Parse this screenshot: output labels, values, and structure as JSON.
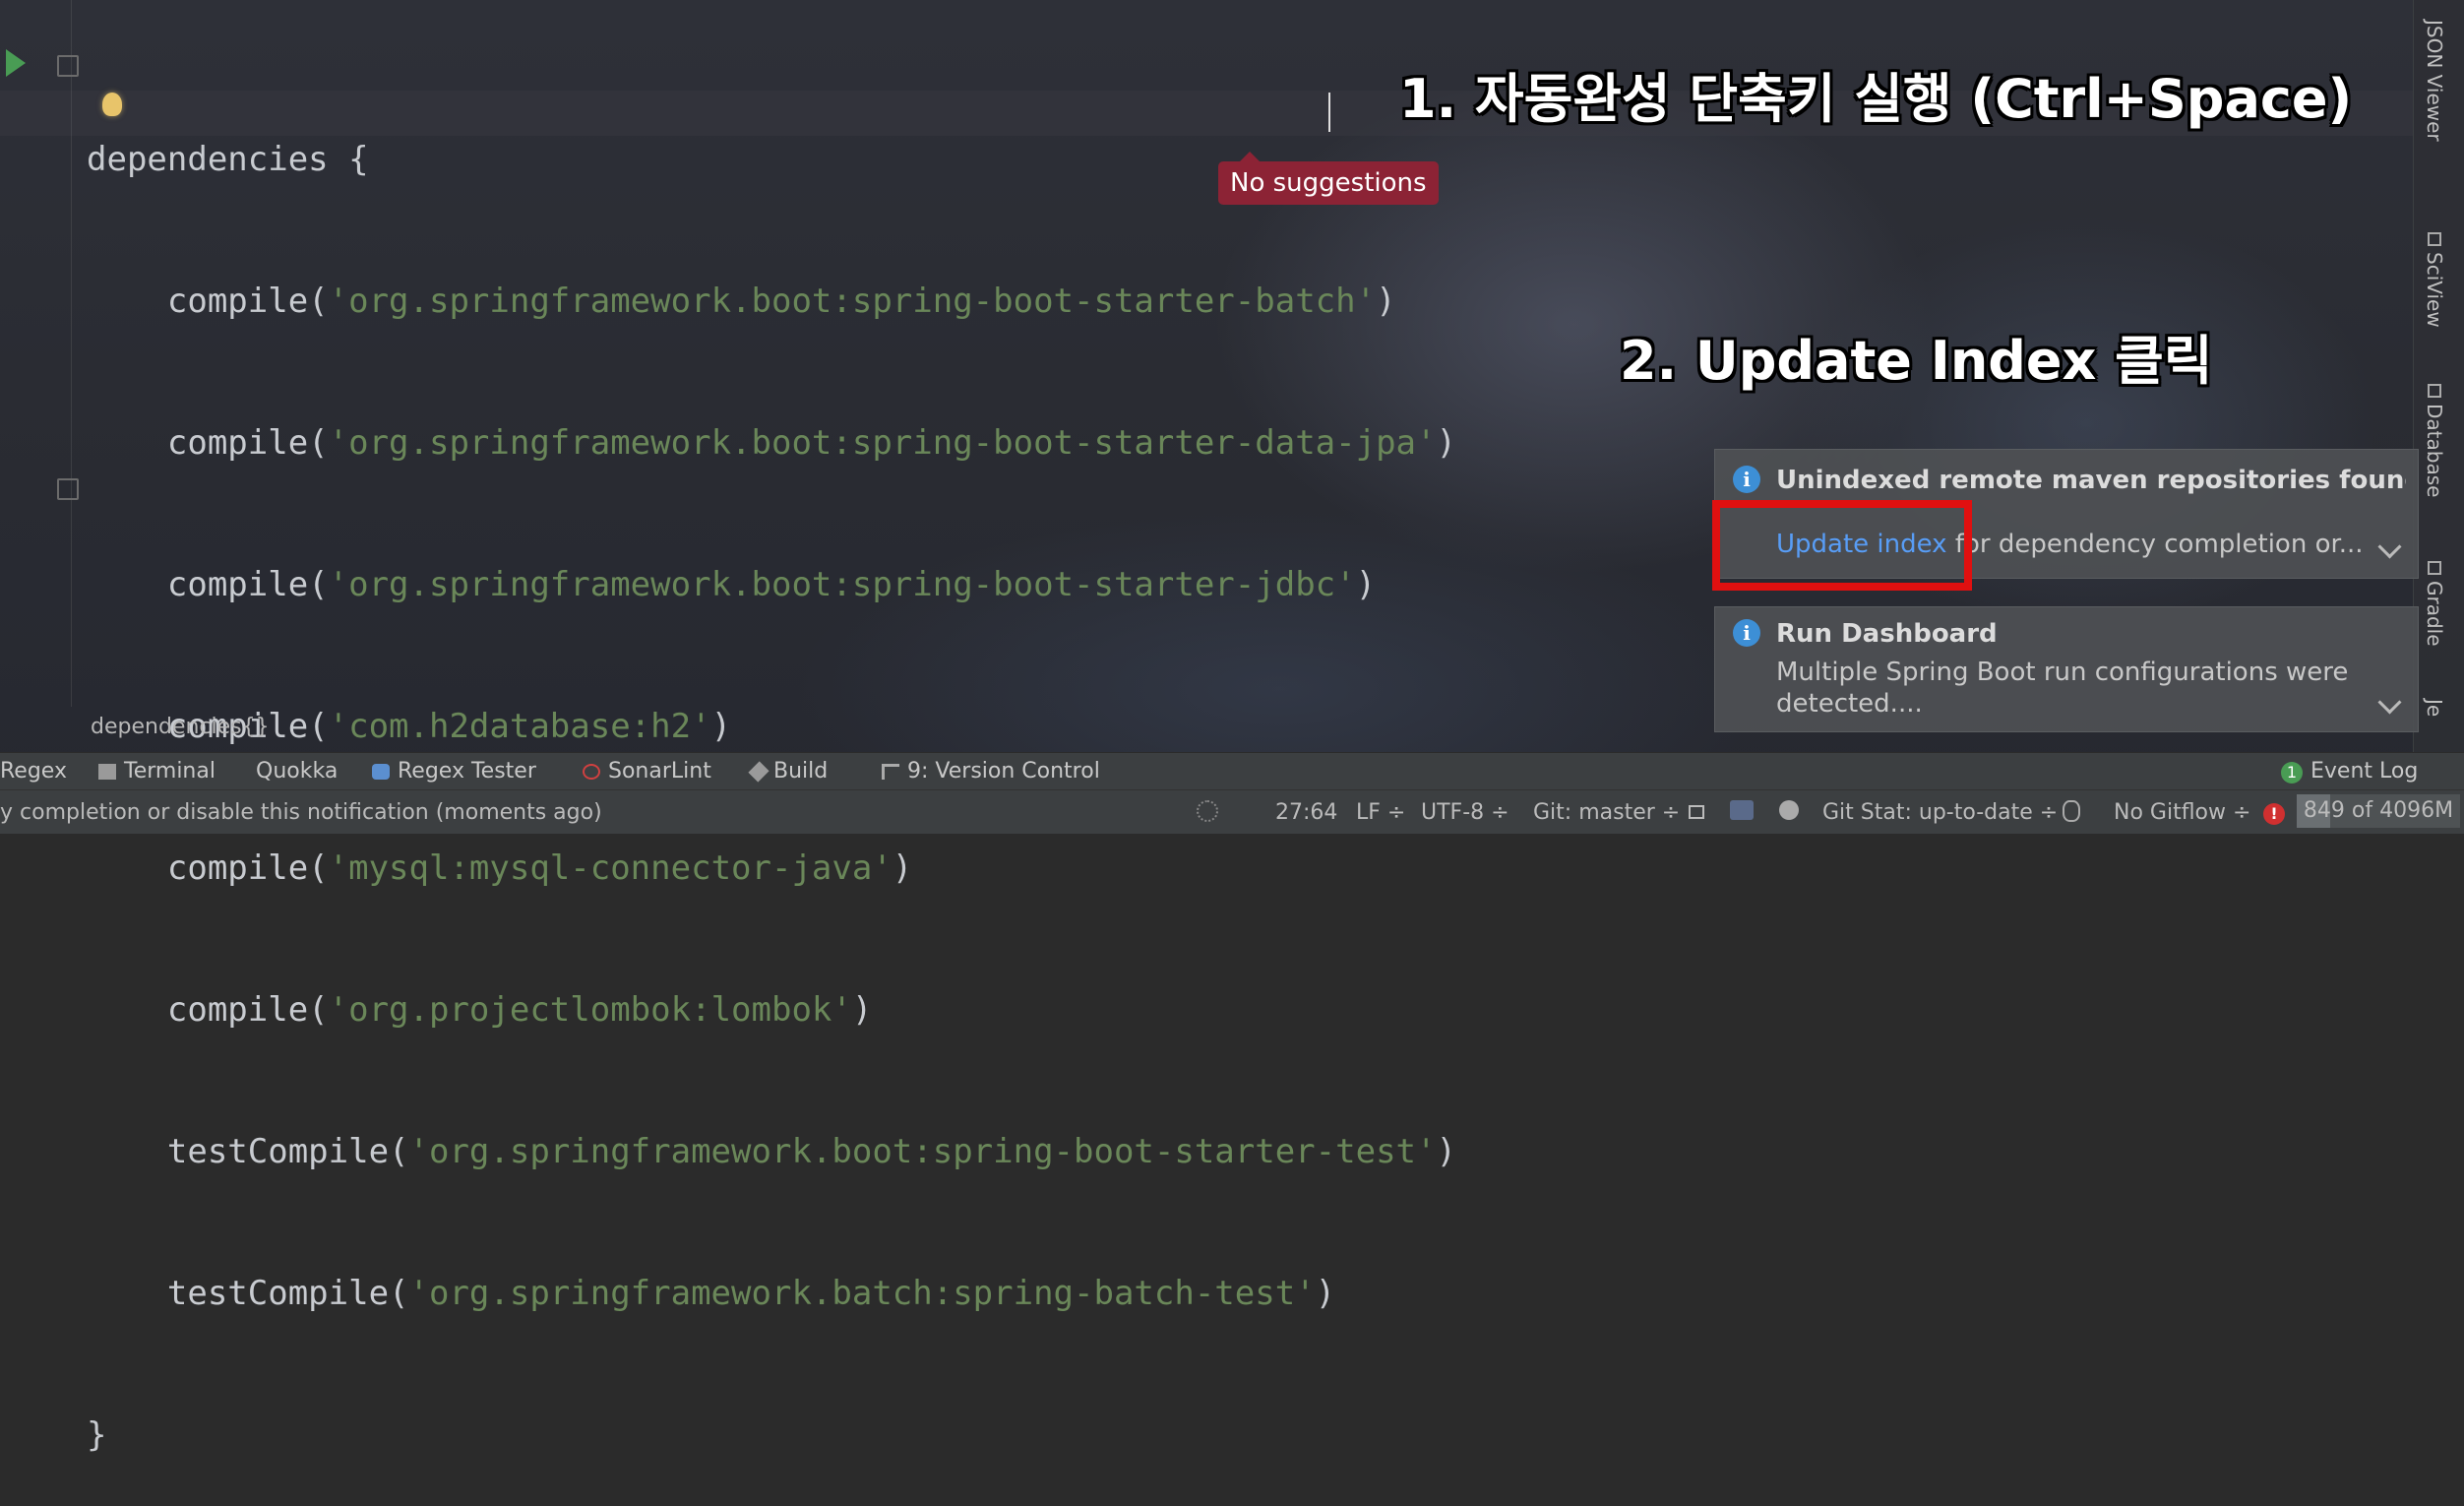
{
  "editor": {
    "lines": [
      {
        "pre": "dependencies {",
        "str": "",
        "post": ""
      },
      {
        "pre": "    compile(",
        "str": "'org.springframework.boot:spring-boot-starter-batch'",
        "post": ")"
      },
      {
        "pre": "    compile(",
        "str": "'org.springframework.boot:spring-boot-starter-data-jpa'",
        "post": ")"
      },
      {
        "pre": "    compile(",
        "str": "'org.springframework.boot:spring-boot-starter-jdbc'",
        "post": ")"
      },
      {
        "pre": "    compile(",
        "str": "'com.h2database:h2'",
        "post": ")"
      },
      {
        "pre": "    compile(",
        "str": "'mysql:mysql-connector-java'",
        "post": ")"
      },
      {
        "pre": "    compile(",
        "str": "'org.projectlombok:lombok'",
        "post": ")"
      },
      {
        "pre": "    testCompile(",
        "str": "'org.springframework.boot:spring-boot-starter-test'",
        "post": ")"
      },
      {
        "pre": "    testCompile(",
        "str": "'org.springframework.batch:spring-batch-test'",
        "post": ")"
      },
      {
        "pre": "}",
        "str": "",
        "post": ""
      }
    ],
    "tooltip": "No suggestions",
    "breadcrumb": "dependencies{}"
  },
  "annotations": {
    "step1": "1. 자동완성 단축키 실행 (Ctrl+Space)",
    "step2": "2. Update Index 클릭"
  },
  "notifications": [
    {
      "title": "Unindexed remote maven repositories found",
      "link": "Update index",
      "body": " for dependency completion or..."
    },
    {
      "title": "Run Dashboard",
      "body": "Multiple Spring Boot run configurations were detected...."
    }
  ],
  "right_tabs": [
    "JSON Viewer",
    "SciView",
    "Database",
    "Gradle",
    "Je"
  ],
  "toolbar": {
    "items": [
      "Regex",
      "Terminal",
      "Quokka",
      "Regex Tester",
      "SonarLint",
      "Build",
      "9: Version Control"
    ],
    "event_log": "Event Log",
    "event_count": "1"
  },
  "status": {
    "message": "y completion or disable this notification (moments ago)",
    "position": "27:64",
    "line_sep": "LF ÷",
    "encoding": "UTF-8 ÷",
    "git_branch": "Git: master ÷",
    "git_stat": "Git Stat: up-to-date ÷",
    "gitflow": "No Gitflow ÷",
    "memory": "849 of 4096M",
    "memory_fraction": 0.207
  },
  "colors": {
    "string": "#6a8759",
    "tooltip": "#8c2335",
    "highlight": "#e01010",
    "link": "#589df6"
  }
}
